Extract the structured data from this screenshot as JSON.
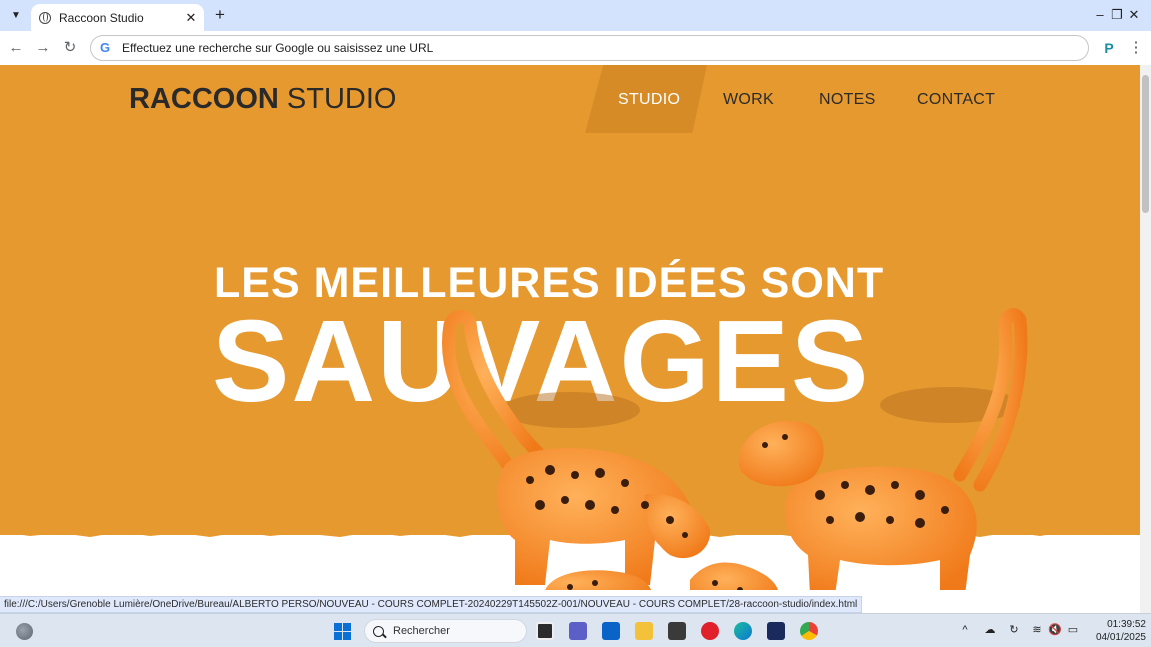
{
  "browser": {
    "tab_title": "Raccoon Studio",
    "tab_close": "✕",
    "new_tab": "+",
    "minimize": "–",
    "maximize": "❐",
    "close": "✕",
    "back": "←",
    "forward": "→",
    "reload": "↻",
    "omnibox_placeholder": "Effectuez une recherche sur Google ou saisissez une URL",
    "menu": "⋮",
    "status_url": "file:///C:/Users/Grenoble Lumière/OneDrive/Bureau/ALBERTO PERSO/NOUVEAU - COURS COMPLET-20240229T145502Z-001/NOUVEAU - COURS COMPLET/28-raccoon-studio/index.html"
  },
  "site": {
    "logo_bold": "RACCOON",
    "logo_thin": " STUDIO",
    "nav": [
      "STUDIO",
      "WORK",
      "NOTES",
      "CONTACT"
    ],
    "active_nav": "STUDIO",
    "headline_line1": "LES MEILLEURES IDÉES SONT",
    "headline_line2": "SAUVAGES",
    "colors": {
      "hero": "#e6992f",
      "nav_active": "#ffffff",
      "text_dark": "#2a2a2a"
    }
  },
  "taskbar": {
    "search_label": "Rechercher",
    "time": "01:39:52",
    "date": "04/01/2025",
    "tray_chevron": "^"
  }
}
